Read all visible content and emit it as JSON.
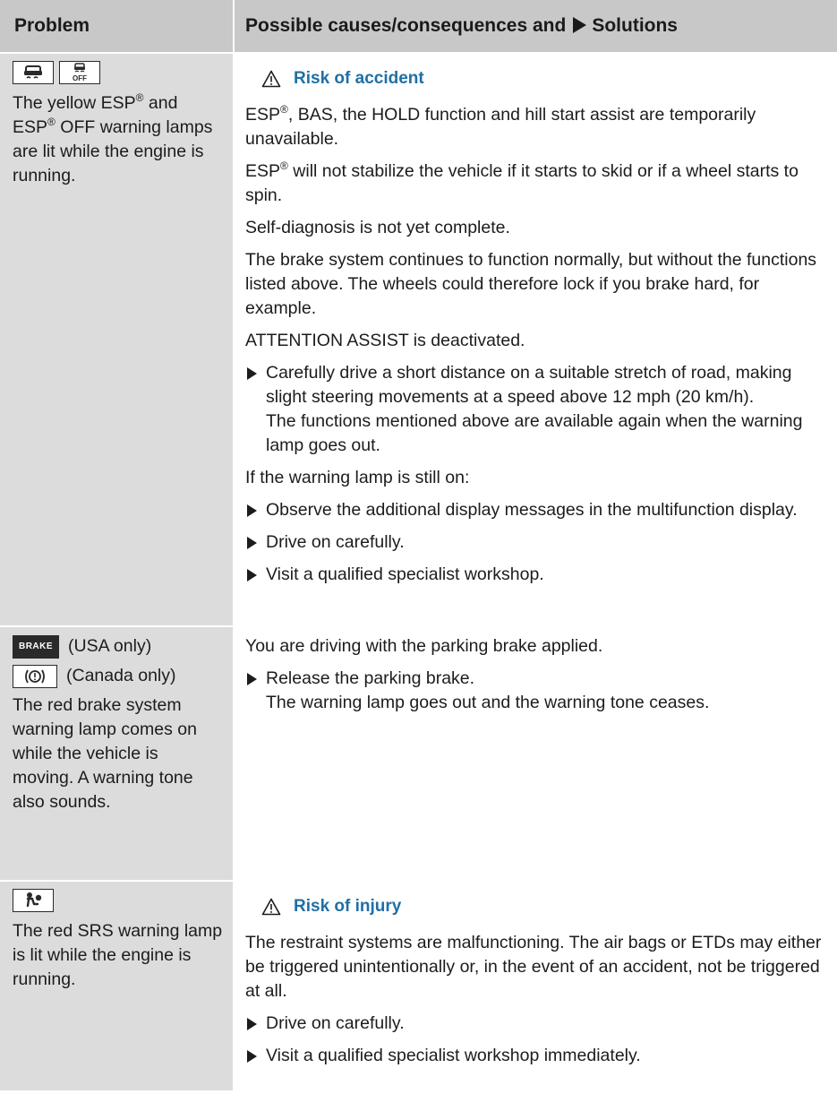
{
  "header": {
    "problem_label": "Problem",
    "solution_label": "Possible causes/consequences and",
    "solution_suffix": "Solutions"
  },
  "rows": [
    {
      "symbols": [
        "esp-icon",
        "esp-off-icon"
      ],
      "problem_pre": "The yellow ESP",
      "problem_mid": " and ESP",
      "problem_post": " OFF warning lamps are lit while the engine is running.",
      "registered": "®",
      "warning_title": "Risk of accident",
      "para1_pre": "ESP",
      "para1_post": ", BAS, the HOLD function and hill start assist are temporarily unavailable.",
      "para2_pre": "ESP",
      "para2_post": " will not stabilize the vehicle if it starts to skid or if a wheel starts to spin.",
      "para3": "Self-diagnosis is not yet complete.",
      "para4": "The brake system continues to function normally, but without the functions listed above. The wheels could therefore lock if you brake hard, for example.",
      "para5": "ATTENTION ASSIST is deactivated.",
      "bullet1": "Carefully drive a short distance on a suitable stretch of road, making slight steering movements at a speed above 12 mph (20 km/h).",
      "bullet1_result": "The functions mentioned above are available again when the warning lamp goes out.",
      "para6": "If the warning lamp is still on:",
      "bullet2": "Observe the additional display messages in the multifunction display.",
      "bullet3": "Drive on carefully.",
      "bullet4": "Visit a qualified specialist workshop."
    },
    {
      "brake_symbol": "BRAKE",
      "usa_note": "(USA only)",
      "canada_note": "(Canada only)",
      "problem": "The red brake system warning lamp comes on while the vehicle is moving. A warning tone also sounds.",
      "para1": "You are driving with the parking brake applied.",
      "bullet1": "Release the parking brake.",
      "bullet1_result": "The warning lamp goes out and the warning tone ceases."
    },
    {
      "symbols": [
        "srs-icon"
      ],
      "problem": "The red SRS warning lamp is lit while the engine is running.",
      "warning_title": "Risk of injury",
      "para1": "The restraint systems are malfunctioning. The air bags or ETDs may either be triggered unintentionally or, in the event of an accident, not be triggered at all.",
      "bullet1": "Drive on carefully.",
      "bullet2": "Visit a qualified specialist workshop immediately."
    }
  ],
  "colors": {
    "header_bg": "#c8c8c8",
    "problem_bg": "#dcdcdc",
    "warning_blue": "#1f6fa6"
  }
}
